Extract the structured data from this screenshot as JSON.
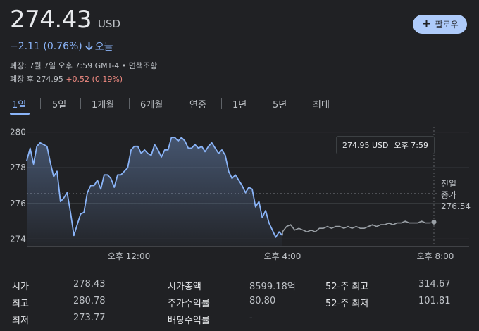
{
  "quote": {
    "price": "274.43",
    "currency": "USD",
    "change": "−2.11 (0.76%)",
    "change_period": "오늘",
    "close_info": "폐장: 7월 7일 오후 7:59 GMT-4 • 면책조항",
    "after_hours_label": "폐장 후 274.95",
    "after_hours_change": "+0.52 (0.19%)"
  },
  "follow_button": {
    "label": "팔로우"
  },
  "tabs": [
    {
      "label": "1일"
    },
    {
      "label": "5일"
    },
    {
      "label": "1개월"
    },
    {
      "label": "6개월"
    },
    {
      "label": "연중"
    },
    {
      "label": "1년"
    },
    {
      "label": "5년"
    },
    {
      "label": "최대"
    }
  ],
  "tooltip": {
    "value": "274.95 USD",
    "time": "오후 7:59"
  },
  "previous_close": {
    "line1": "전일",
    "line2": "종가",
    "value": "276.54"
  },
  "colors": {
    "accent": "#8ab4f8",
    "negative": "#f28b82",
    "after_hours_line": "#9aa0a6",
    "background": "#202124"
  },
  "chart_data": {
    "type": "area",
    "y_ticks": [
      "280",
      "278",
      "276",
      "274"
    ],
    "ylim": [
      273.5,
      280.3
    ],
    "x_ticks": [
      "오후 12:00",
      "오후 4:00",
      "오후 8:00"
    ],
    "previous_close": 276.54,
    "session_series": [
      278.4,
      279.1,
      278.2,
      279.2,
      279.4,
      279.3,
      279.2,
      278.3,
      277.5,
      277.8,
      276.1,
      276.3,
      276.6,
      275.5,
      274.2,
      274.8,
      275.4,
      275.5,
      276.6,
      277.0,
      277.0,
      277.3,
      276.8,
      277.6,
      277.6,
      277.4,
      276.9,
      277.6,
      277.6,
      277.8,
      278.0,
      279.0,
      279.2,
      279.2,
      278.8,
      279.0,
      278.8,
      278.7,
      279.3,
      279.0,
      278.6,
      279.0,
      279.0,
      279.7,
      279.7,
      279.5,
      279.7,
      279.5,
      279.1,
      279.1,
      279.3,
      279.1,
      279.2,
      278.9,
      279.2,
      279.4,
      279.1,
      278.8,
      279.0,
      278.7,
      277.8,
      277.4,
      277.6,
      277.3,
      277.0,
      276.6,
      276.9,
      276.8,
      275.8,
      276.1,
      275.2,
      275.6,
      274.9,
      274.5,
      274.1,
      274.4,
      274.2
    ],
    "after_hours_series": [
      274.4,
      274.7,
      274.8,
      274.5,
      274.6,
      274.5,
      274.4,
      274.5,
      274.4,
      274.6,
      274.6,
      274.7,
      274.6,
      274.7,
      274.7,
      274.6,
      274.7,
      274.6,
      274.7,
      274.6,
      274.6,
      274.7,
      274.8,
      274.7,
      274.8,
      274.8,
      274.9,
      274.8,
      274.9,
      274.9,
      275.0,
      274.9,
      274.9,
      274.9,
      275.0,
      274.9,
      274.9,
      274.95
    ]
  },
  "stats": [
    {
      "label": "시가",
      "value": "278.43"
    },
    {
      "label": "최고",
      "value": "280.78"
    },
    {
      "label": "최저",
      "value": "273.77"
    },
    {
      "label": "시가총액",
      "value": "8599.18억"
    },
    {
      "label": "주가수익률",
      "value": "80.80"
    },
    {
      "label": "배당수익률",
      "value": "-"
    },
    {
      "label": "52-주 최고",
      "value": "314.67"
    },
    {
      "label": "52-주 최저",
      "value": "101.81"
    }
  ]
}
